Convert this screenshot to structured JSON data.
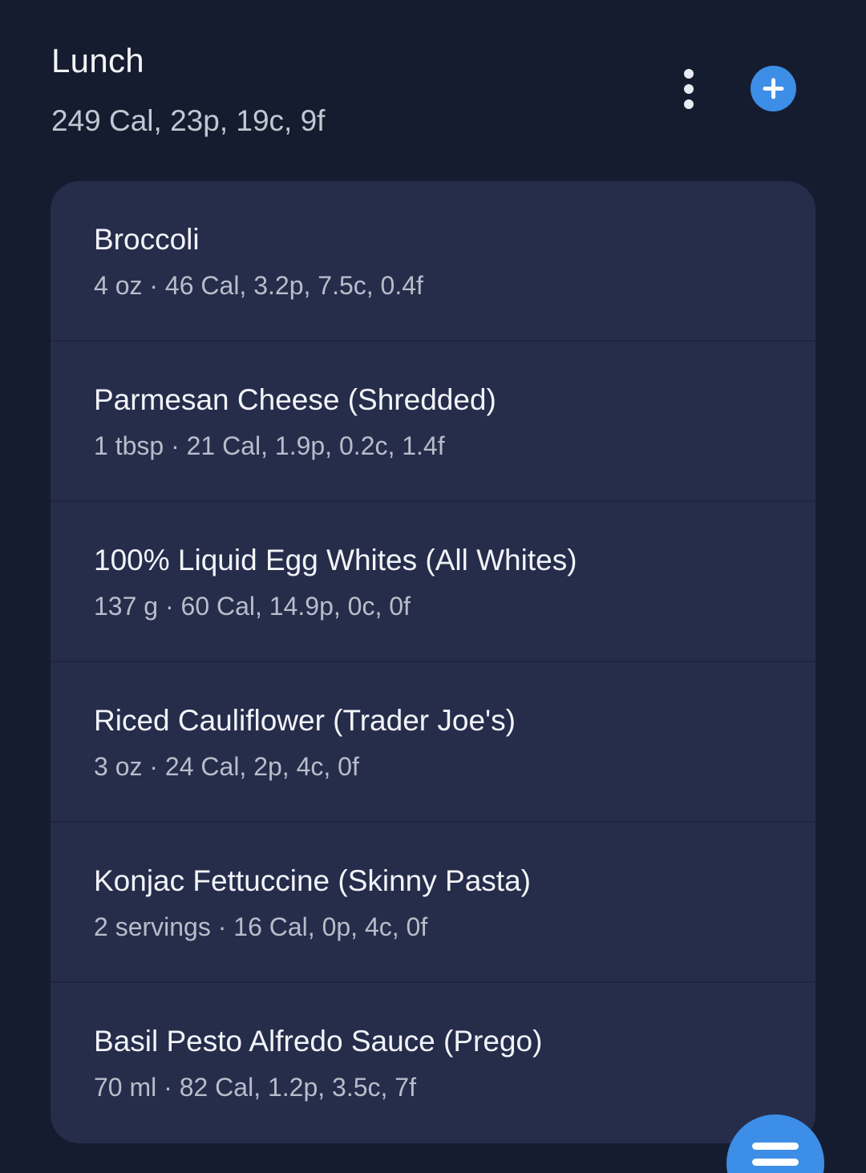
{
  "meal": {
    "title": "Lunch",
    "summary": "249 Cal, 23p, 19c, 9f"
  },
  "header_actions": {
    "more_icon": "more-vertical-icon",
    "add_icon": "plus-icon",
    "add_color": "#3c8ee6"
  },
  "items": [
    {
      "name": "Broccoli",
      "detail": "4 oz · 46 Cal, 3.2p, 7.5c, 0.4f"
    },
    {
      "name": "Parmesan Cheese (Shredded)",
      "detail": "1 tbsp · 21 Cal, 1.9p, 0.2c, 1.4f"
    },
    {
      "name": "100% Liquid Egg Whites (All Whites)",
      "detail": "137 g · 60 Cal, 14.9p, 0c, 0f"
    },
    {
      "name": "Riced Cauliflower (Trader Joe's)",
      "detail": "3 oz · 24 Cal, 2p, 4c, 0f"
    },
    {
      "name": "Konjac Fettuccine (Skinny Pasta)",
      "detail": "2 servings · 16 Cal, 0p, 4c, 0f"
    },
    {
      "name": "Basil Pesto Alfredo Sauce (Prego)",
      "detail": "70 ml · 82 Cal, 1.2p, 3.5c, 7f"
    }
  ],
  "fab": {
    "icon": "menu-icon"
  },
  "colors": {
    "background": "#161c2f",
    "card": "#262d4b",
    "accent": "#3c8ee6"
  }
}
